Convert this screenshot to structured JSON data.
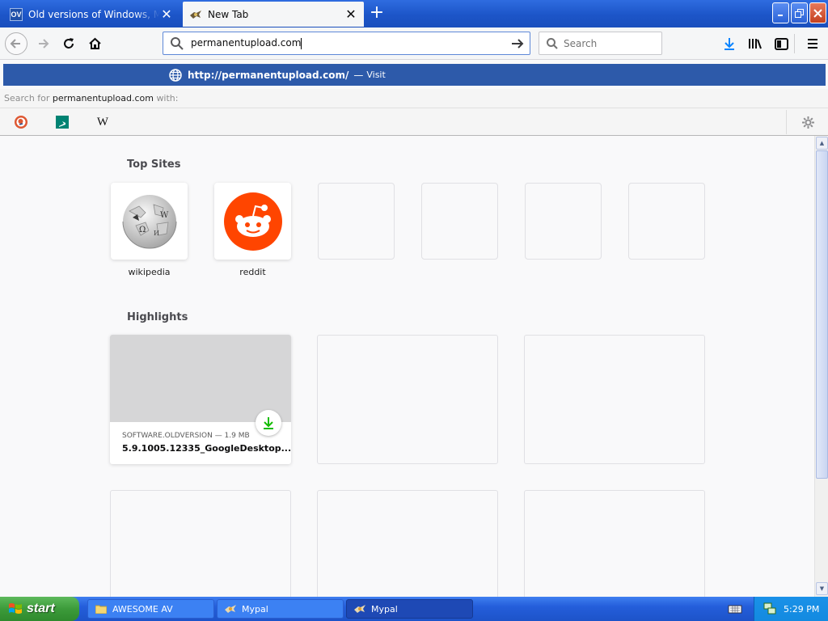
{
  "tabs": [
    {
      "title": "Old versions of Windows, Mac and",
      "icon": "oldversion-icon",
      "favicon_text": "OV"
    },
    {
      "title": "New Tab",
      "icon": "mypal-icon"
    }
  ],
  "navbar": {
    "url_value": "permanentupload.com",
    "search_placeholder": "Search"
  },
  "suggestion": {
    "url": "http://permanentupload.com/",
    "dash": "—",
    "action": "Visit",
    "bg_color": "#2d5aaa"
  },
  "search_with": {
    "prefix": "Search for",
    "term": "permanentupload.com",
    "suffix": "with:",
    "engines": [
      "duckduckgo-icon",
      "bing-icon",
      "wikipedia-icon"
    ],
    "wiki_glyph": "W"
  },
  "top_sites": {
    "title": "Top Sites",
    "sites": [
      {
        "label": "wikipedia",
        "icon": "wikipedia-globe-icon"
      },
      {
        "label": "reddit",
        "icon": "reddit-icon"
      }
    ],
    "empty_slots": 4
  },
  "highlights": {
    "title": "Highlights",
    "card": {
      "meta": "SOFTWARE.OLDVERSION — 1.9 MB",
      "title": "5.9.1005.12335_GoogleDesktop..."
    },
    "empty_cards": 5
  },
  "taskbar": {
    "start_label": "start",
    "tasks": [
      {
        "label": "AWESOME AV",
        "icon": "folder-icon",
        "active": false
      },
      {
        "label": "Mypal",
        "icon": "mypal-icon",
        "active": false
      },
      {
        "label": "Mypal",
        "icon": "mypal-icon",
        "active": true
      }
    ],
    "clock": "5:29 PM"
  },
  "colors": {
    "titlebar": "#1c55c8",
    "accent_download": "#12bc00",
    "reddit": "#ff4500"
  }
}
